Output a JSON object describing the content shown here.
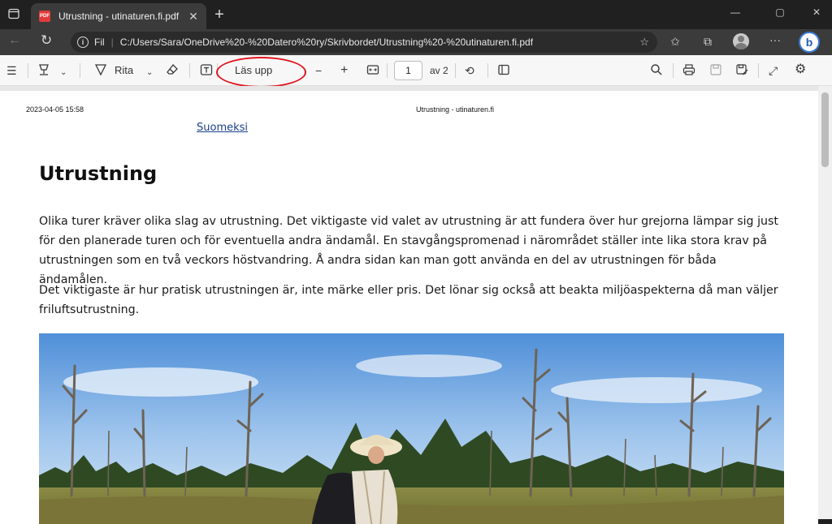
{
  "tab": {
    "title": "Utrustning - utinaturen.fi.pdf",
    "favicon_text": "PDF"
  },
  "address": {
    "scheme_label": "Fil",
    "url": "C:/Users/Sara/OneDrive%20-%20Datero%20ry/Skrivbordet/Utrustning%20-%20utinaturen.fi.pdf"
  },
  "profile": {
    "bing_label": "b"
  },
  "pdf_toolbar": {
    "draw_label": "Rita",
    "read_aloud_label": "Läs upp",
    "page_current": "1",
    "page_total_label": "av 2"
  },
  "document": {
    "header_date": "2023-04-05 15:58",
    "header_title": "Utrustning - utinaturen.fi",
    "language_link": "Suomeksi",
    "heading": "Utrustning",
    "paragraph1": "Olika turer kräver olika slag av utrustning. Det viktigaste vid valet av utrustning är att fundera över hur grejorna lämpar sig just för den planerade turen och för eventuella andra ändamål. En stavgångspromenad i närområdet ställer inte lika stora krav på utrustningen som en två veckors höstvandring. Å andra sidan kan man gott använda en del av utrustningen för båda ändamålen.",
    "paragraph2": "Det viktigaste är hur pratisk utrustningen är, inte märke eller pris. Det lönar sig också att beakta miljöaspekterna då man väljer friluftsutrustning."
  },
  "colors": {
    "annotation_circle": "#e0141e",
    "link": "#1a3f8a",
    "chrome_dark": "#202020",
    "chrome_mid": "#3b3b3b"
  }
}
